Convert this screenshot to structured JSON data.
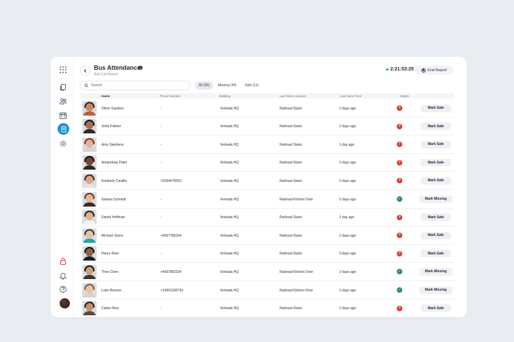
{
  "header": {
    "title": "Bus Attendance",
    "subtitle": "Roll Call Report",
    "timer": "2:21:53:25",
    "end_label": "End Report"
  },
  "search": {
    "placeholder": "Search"
  },
  "filters": [
    {
      "label": "All (55)",
      "active": true
    },
    {
      "label": "Missing (44)",
      "active": false
    },
    {
      "label": "Safe (11)",
      "active": false
    }
  ],
  "columns": {
    "name": "Name",
    "phone": "Phone Number",
    "building": "Building",
    "location": "Last Seen Location",
    "time": "Last Seen Time",
    "status": "Status"
  },
  "rows": [
    {
      "name": "Oliver Gardner",
      "phone": "-",
      "building": "Verkada HQ",
      "location": "Railroad Stairs",
      "time": "2 days ago",
      "status": "missing",
      "action": "Mark Safe",
      "skin": "#c88a64",
      "hair": "#3b2416",
      "shirt": "#b95f3b"
    },
    {
      "name": "Sofia Palmer",
      "phone": "-",
      "building": "Verkada HQ",
      "location": "Railroad Stairs",
      "time": "2 days ago",
      "status": "missing",
      "action": "Mark Safe",
      "skin": "#a86d4e",
      "hair": "#1e1512",
      "shirt": "#2a2a2a"
    },
    {
      "name": "Amy Stephens",
      "phone": "-",
      "building": "Verkada HQ",
      "location": "Railroad Stairs",
      "time": "1 day ago",
      "status": "missing",
      "action": "Mark Safe",
      "skin": "#e2b39a",
      "hair": "#8a2e22",
      "shirt": "#d9d4cf"
    },
    {
      "name": "Amandeep Patel",
      "phone": "-",
      "building": "Verkada HQ",
      "location": "Railroad Stairs",
      "time": "2 days ago",
      "status": "missing",
      "action": "Mark Safe",
      "skin": "#6e4a36",
      "hair": "#141010",
      "shirt": "#2b2623"
    },
    {
      "name": "Kimberly Castillo",
      "phone": "+5034476552",
      "building": "Verkada HQ",
      "location": "Railroad Stairs",
      "time": "2 days ago",
      "status": "missing",
      "action": "Mark Safe",
      "skin": "#d9a88a",
      "hair": "#4a2c1c",
      "shirt": "#e8e4e0"
    },
    {
      "name": "Gianna Schmidt",
      "phone": "-",
      "building": "Verkada HQ",
      "location": "Railroad Kitchen Door",
      "time": "2 days ago",
      "status": "safe",
      "action": "Mark Missing",
      "skin": "#e6b898",
      "hair": "#6b3b1e",
      "shirt": "#3a2a24"
    },
    {
      "name": "Daniel Hoffman",
      "phone": "-",
      "building": "Verkada HQ",
      "location": "Railroad Stairs",
      "time": "1 day ago",
      "status": "missing",
      "action": "Mark Safe",
      "skin": "#e0b090",
      "hair": "#2a2018",
      "shirt": "#f2f2f2"
    },
    {
      "name": "Michael Stone",
      "phone": "+6507786334",
      "building": "Verkada HQ",
      "location": "Railroad Stairs",
      "time": "2 days ago",
      "status": "missing",
      "action": "Mark Safe",
      "skin": "#e3c2a8",
      "hair": "#3a3a3a",
      "shirt": "#27a3a0"
    },
    {
      "name": "Henry Reid",
      "phone": "-",
      "building": "Verkada HQ",
      "location": "Railroad Stairs",
      "time": "3 days ago",
      "status": "missing",
      "action": "Mark Safe",
      "skin": "#8c6248",
      "hair": "#1a1412",
      "shirt": "#1e1e1e"
    },
    {
      "name": "Theo Chen",
      "phone": "+4567882334",
      "building": "Verkada HQ",
      "location": "Railroad Kitchen Door",
      "time": "2 days ago",
      "status": "safe",
      "action": "Mark Missing",
      "skin": "#caa07e",
      "hair": "#1c1612",
      "shirt": "#3a3836"
    },
    {
      "name": "Luke Benson",
      "phone": "+15961168793",
      "building": "Verkada HQ",
      "location": "Railroad Kitchen Door",
      "time": "2 days ago",
      "status": "safe",
      "action": "Mark Missing",
      "skin": "#e8c2a4",
      "hair": "#8a5a34",
      "shirt": "#d8d2cc"
    },
    {
      "name": "Carter Rios",
      "phone": "-",
      "building": "Verkada HQ",
      "location": "Railroad Stairs",
      "time": "2 days ago",
      "status": "missing",
      "action": "Mark Safe",
      "skin": "#c49070",
      "hair": "#2a1e16",
      "shirt": "#5a4a40"
    }
  ],
  "sidebar": {
    "icons": [
      "apps-grid-icon",
      "copy-icon",
      "users-icon",
      "calendar-icon",
      "report-icon",
      "settings-icon",
      "lock-icon",
      "bell-icon",
      "help-icon"
    ]
  },
  "colors": {
    "accent": "#1a8fd1",
    "missing": "#d83a34",
    "safe": "#2f8f4e",
    "live": "#2fb566"
  }
}
